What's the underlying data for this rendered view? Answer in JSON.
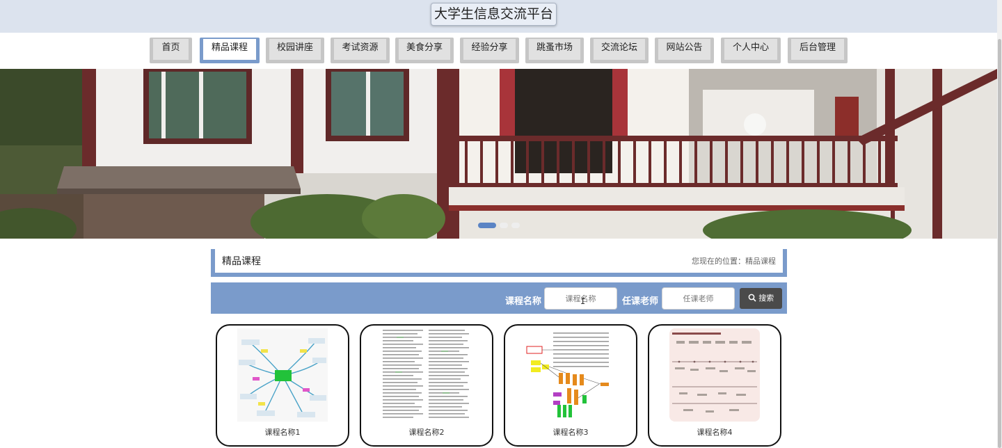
{
  "header": {
    "title": "大学生信息交流平台"
  },
  "nav": {
    "items": [
      {
        "label": "首页"
      },
      {
        "label": "精品课程"
      },
      {
        "label": "校园讲座"
      },
      {
        "label": "考试资源"
      },
      {
        "label": "美食分享"
      },
      {
        "label": "经验分享"
      },
      {
        "label": "跳蚤市场"
      },
      {
        "label": "交流论坛"
      },
      {
        "label": "网站公告"
      },
      {
        "label": "个人中心"
      },
      {
        "label": "后台管理"
      }
    ],
    "active": "精品课程"
  },
  "banner": {
    "slide_count": 3,
    "active_slide": 1
  },
  "section": {
    "title": "精品课程",
    "breadcrumb": "您现在的位置：精品课程"
  },
  "search": {
    "course_label": "课程名称",
    "course_placeholder": "课程名称",
    "teacher_label": "任课老师",
    "teacher_placeholder": "任课老师",
    "button_label": "搜索",
    "button_icon": "search-icon"
  },
  "cards": [
    {
      "label": "课程名称1"
    },
    {
      "label": "课程名称2"
    },
    {
      "label": "课程名称3"
    },
    {
      "label": "课程名称4"
    }
  ],
  "colors": {
    "accent": "#7a9bcb",
    "header_bg": "#dce3ee",
    "button_dark": "#4a4a4a"
  }
}
